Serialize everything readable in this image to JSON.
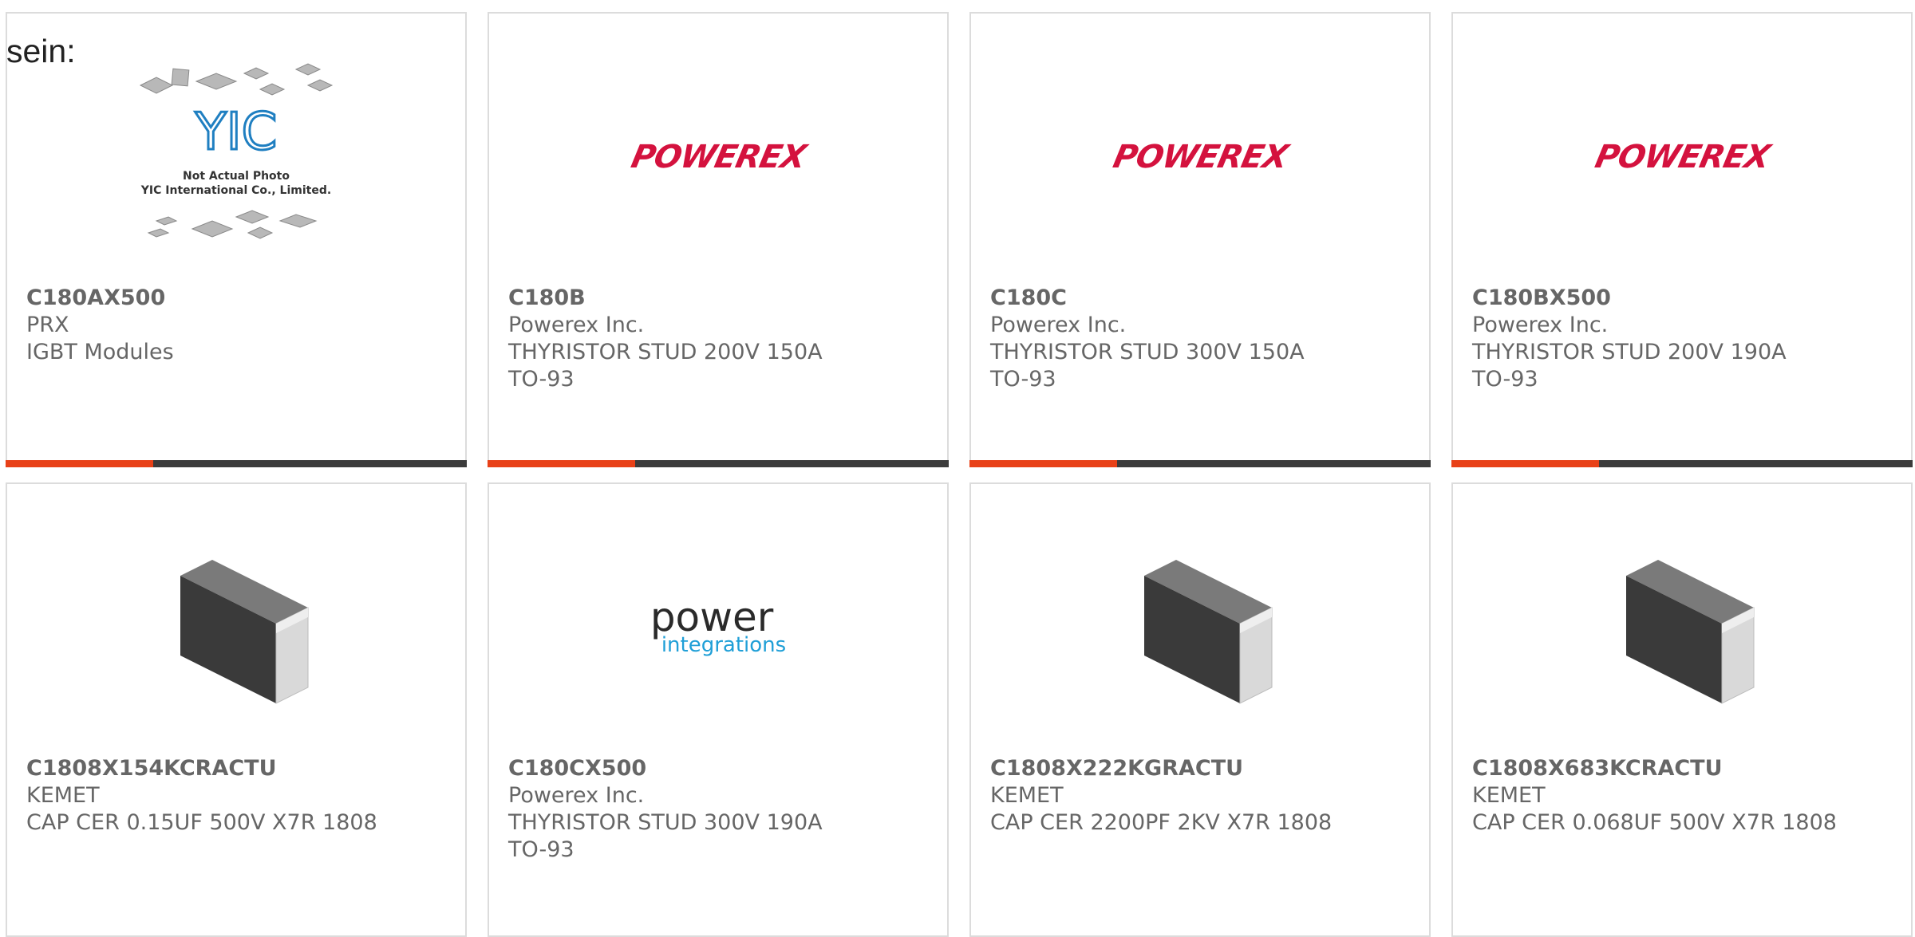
{
  "intro_text": "sein:",
  "placeholder": {
    "line1": "Not Actual Photo",
    "line2": "YIC International Co., Limited.",
    "logo": "YIC"
  },
  "brand_logos": {
    "powerex": "POWEREX",
    "power_integrations_word": "power",
    "power_integrations_sub": "integrations"
  },
  "colors": {
    "accent": "#e84118",
    "bar_dark": "#3b3b3b",
    "card_border": "#dcdcdc",
    "text": "#666666",
    "powerex_red": "#d4123e",
    "power_integrations_blue": "#1f9fd7"
  },
  "products": [
    {
      "part": "C180AX500",
      "maker": "PRX",
      "desc": "IGBT Modules",
      "pkg": "",
      "image": "yic-placeholder"
    },
    {
      "part": "C180B",
      "maker": "Powerex Inc.",
      "desc": "THYRISTOR STUD 200V 150A",
      "pkg": "TO-93",
      "image": "powerex-logo"
    },
    {
      "part": "C180C",
      "maker": "Powerex Inc.",
      "desc": "THYRISTOR STUD 300V 150A",
      "pkg": "TO-93",
      "image": "powerex-logo"
    },
    {
      "part": "C180BX500",
      "maker": "Powerex Inc.",
      "desc": "THYRISTOR STUD 200V 190A",
      "pkg": "TO-93",
      "image": "powerex-logo"
    },
    {
      "part": "C1808X154KCRACTU",
      "maker": "KEMET",
      "desc": "CAP CER 0.15UF 500V X7R 1808",
      "pkg": "",
      "image": "chip-capacitor"
    },
    {
      "part": "C180CX500",
      "maker": "Powerex Inc.",
      "desc": "THYRISTOR STUD 300V 190A",
      "pkg": "TO-93",
      "image": "power-integrations-logo"
    },
    {
      "part": "C1808X222KGRACTU",
      "maker": "KEMET",
      "desc": "CAP CER 2200PF 2KV X7R 1808",
      "pkg": "",
      "image": "chip-capacitor"
    },
    {
      "part": "C1808X683KCRACTU",
      "maker": "KEMET",
      "desc": "CAP CER 0.068UF 500V X7R 1808",
      "pkg": "",
      "image": "chip-capacitor"
    }
  ]
}
